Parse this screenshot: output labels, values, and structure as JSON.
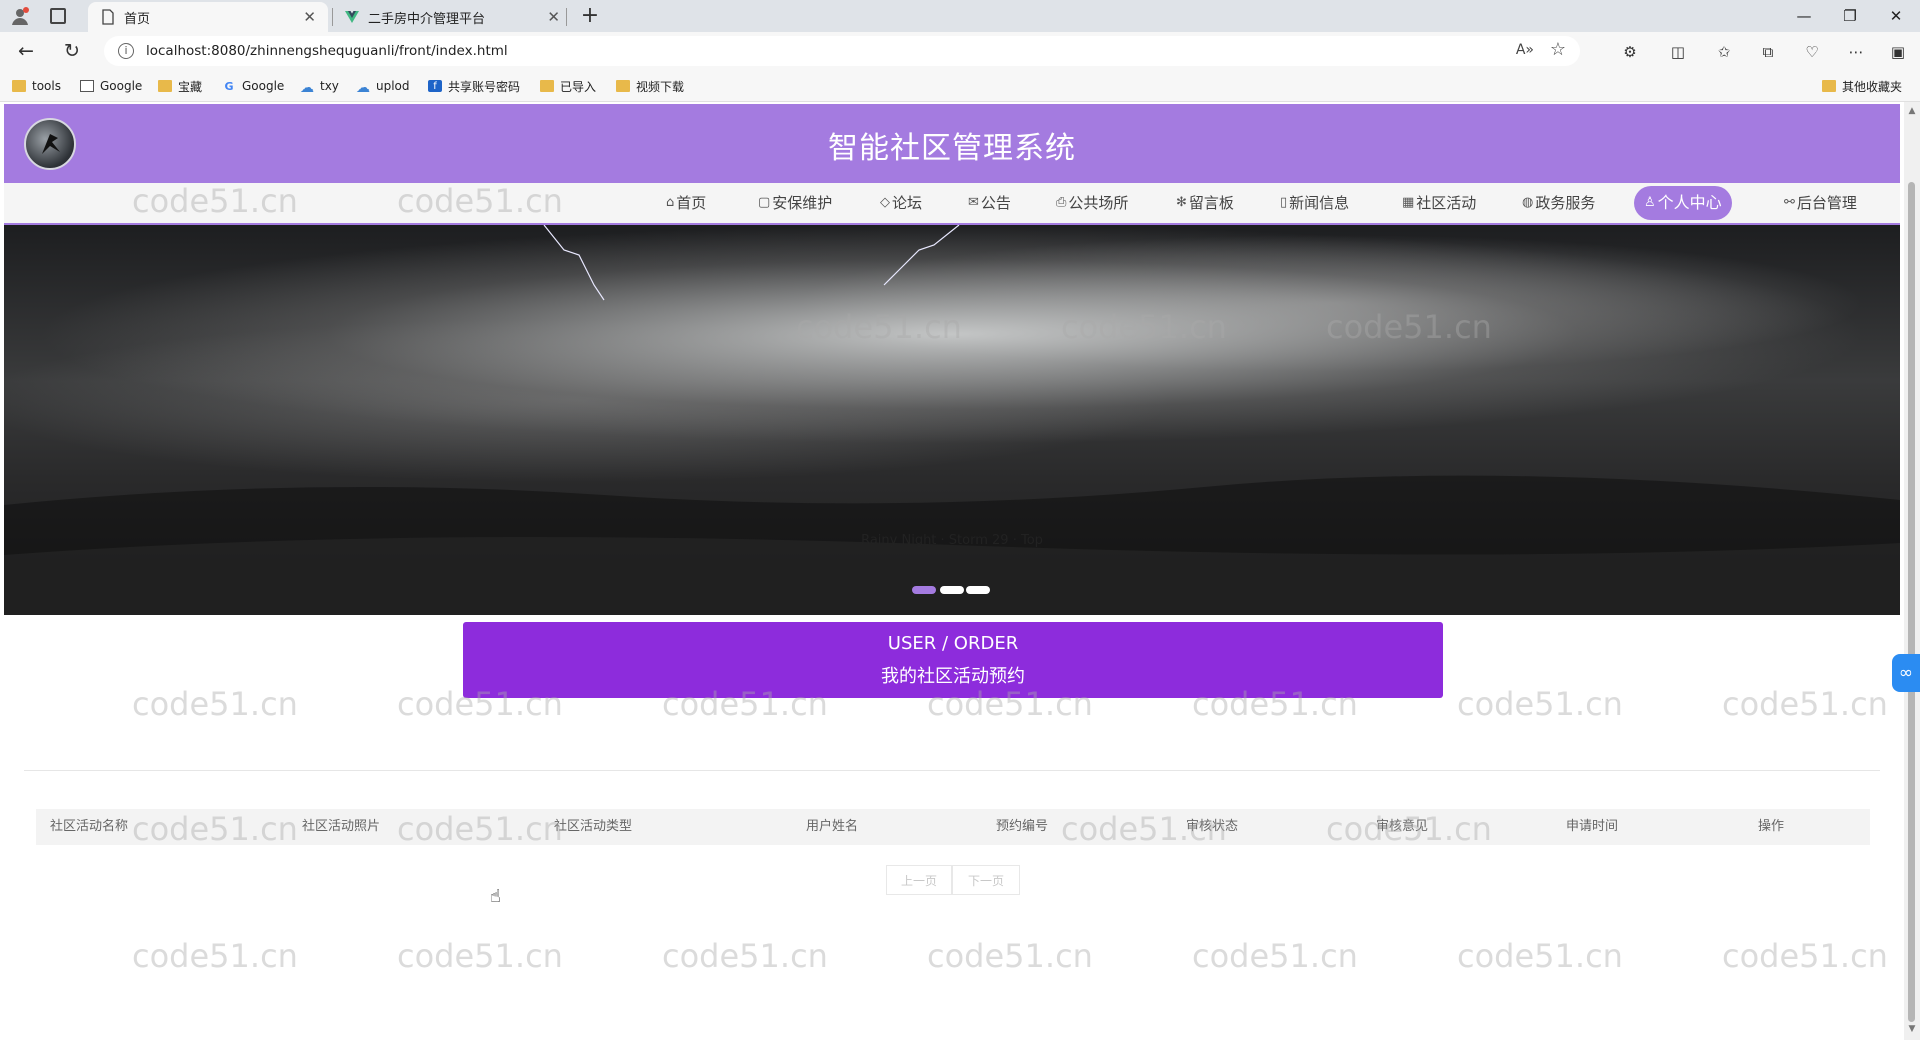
{
  "browser": {
    "tabs": [
      {
        "title": "首页",
        "active": true
      },
      {
        "title": "二手房中介管理平台",
        "active": false
      }
    ],
    "url": "localhost:8080/zhinnengshequguanli/front/index.html",
    "bookmarks": [
      {
        "label": "tools",
        "icon": "folder-icon"
      },
      {
        "label": "Google",
        "icon": "page-icon"
      },
      {
        "label": "宝藏",
        "icon": "folder-icon"
      },
      {
        "label": "Google",
        "icon": "google-icon"
      },
      {
        "label": "txy",
        "icon": "cloud-icon"
      },
      {
        "label": "uplod",
        "icon": "cloud-icon"
      },
      {
        "label": "共享账号密码",
        "icon": "app-icon"
      },
      {
        "label": "已导入",
        "icon": "folder-icon"
      },
      {
        "label": "视频下载",
        "icon": "folder-icon"
      }
    ],
    "other_bookmarks": "其他收藏夹"
  },
  "site": {
    "title": "智能社区管理系统",
    "accent_color": "#a47be0",
    "nav": [
      {
        "label": "首页",
        "icon": "home-icon"
      },
      {
        "label": "安保维护",
        "icon": "calendar-icon"
      },
      {
        "label": "论坛",
        "icon": "tag-icon"
      },
      {
        "label": "公告",
        "icon": "mail-icon"
      },
      {
        "label": "公共场所",
        "icon": "printer-icon"
      },
      {
        "label": "留言板",
        "icon": "snowflake-icon"
      },
      {
        "label": "新闻信息",
        "icon": "note-icon"
      },
      {
        "label": "社区活动",
        "icon": "grid-icon"
      },
      {
        "label": "政务服务",
        "icon": "globe-icon"
      },
      {
        "label": "个人中心",
        "icon": "user-icon",
        "active": true
      },
      {
        "label": "后台管理",
        "icon": "link-icon"
      }
    ]
  },
  "banner": {
    "caption": "Rainy Night · Storm 29 · Top",
    "slides": 3,
    "active_slide": 0
  },
  "section": {
    "title_en": "USER / ORDER",
    "title_cn": "我的社区活动预约",
    "header_color": "#8d2cdc"
  },
  "table": {
    "columns": [
      "社区活动名称",
      "社区活动照片",
      "社区活动类型",
      "用户姓名",
      "预约编号",
      "审核状态",
      "审核意见",
      "申请时间",
      "操作"
    ],
    "rows": []
  },
  "pager": {
    "prev": "上一页",
    "next": "下一页"
  },
  "watermark": "code51.cn"
}
